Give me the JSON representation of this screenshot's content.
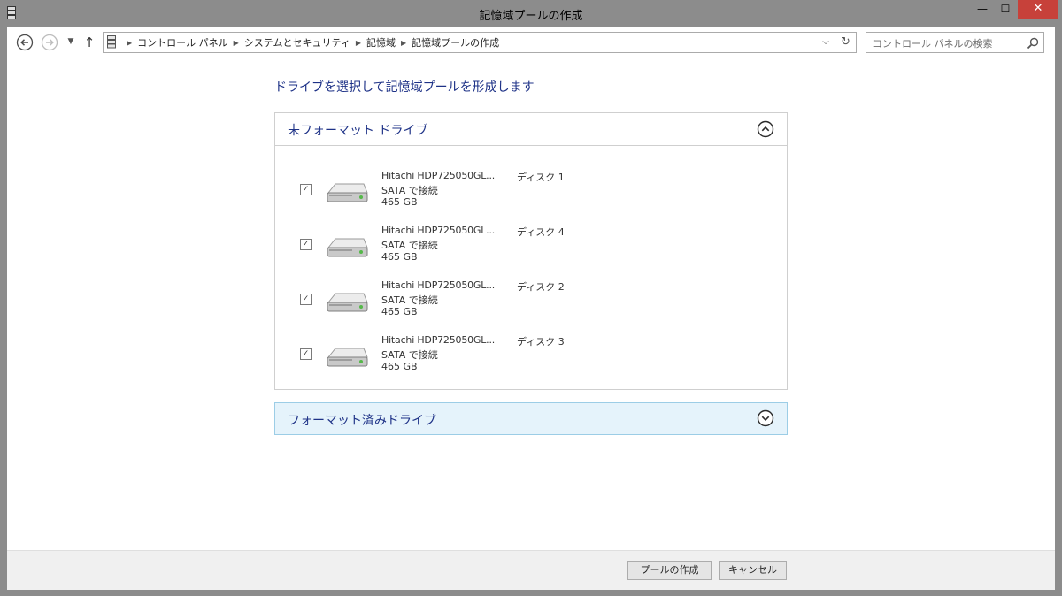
{
  "window": {
    "title": "記憶域プールの作成",
    "min_glyph": "—",
    "max_glyph": "☐",
    "close_glyph": "✕"
  },
  "nav": {
    "back_icon": "back-arrow-icon",
    "forward_icon": "forward-arrow-icon",
    "recent_glyph": "▼",
    "up_glyph": "↑"
  },
  "address": {
    "crumbs": [
      "コントロール パネル",
      "システムとセキュリティ",
      "記憶域",
      "記憶域プールの作成"
    ],
    "separator": "▶",
    "dropdown_glyph": "⌵",
    "refresh_glyph": "↻"
  },
  "search": {
    "placeholder": "コントロール パネルの検索"
  },
  "heading": "ドライブを選択して記憶域プールを形成します",
  "unformatted": {
    "title": "未フォーマット ドライブ",
    "drives": [
      {
        "name": "Hitachi HDP725050GL...",
        "disk": "ディスク 1",
        "connection": "SATA で接続",
        "size": "465 GB",
        "checked": true
      },
      {
        "name": "Hitachi HDP725050GL...",
        "disk": "ディスク 4",
        "connection": "SATA で接続",
        "size": "465 GB",
        "checked": true
      },
      {
        "name": "Hitachi HDP725050GL...",
        "disk": "ディスク 2",
        "connection": "SATA で接続",
        "size": "465 GB",
        "checked": true
      },
      {
        "name": "Hitachi HDP725050GL...",
        "disk": "ディスク 3",
        "connection": "SATA で接続",
        "size": "465 GB",
        "checked": true
      }
    ]
  },
  "formatted": {
    "title": "フォーマット済みドライブ"
  },
  "footer": {
    "create_label": "プールの作成",
    "cancel_label": "キャンセル"
  },
  "colors": {
    "accent_text": "#1e3287",
    "close_button": "#c7413a",
    "frame": "#8c8c8c",
    "panel_highlight": "#e5f3fb"
  }
}
